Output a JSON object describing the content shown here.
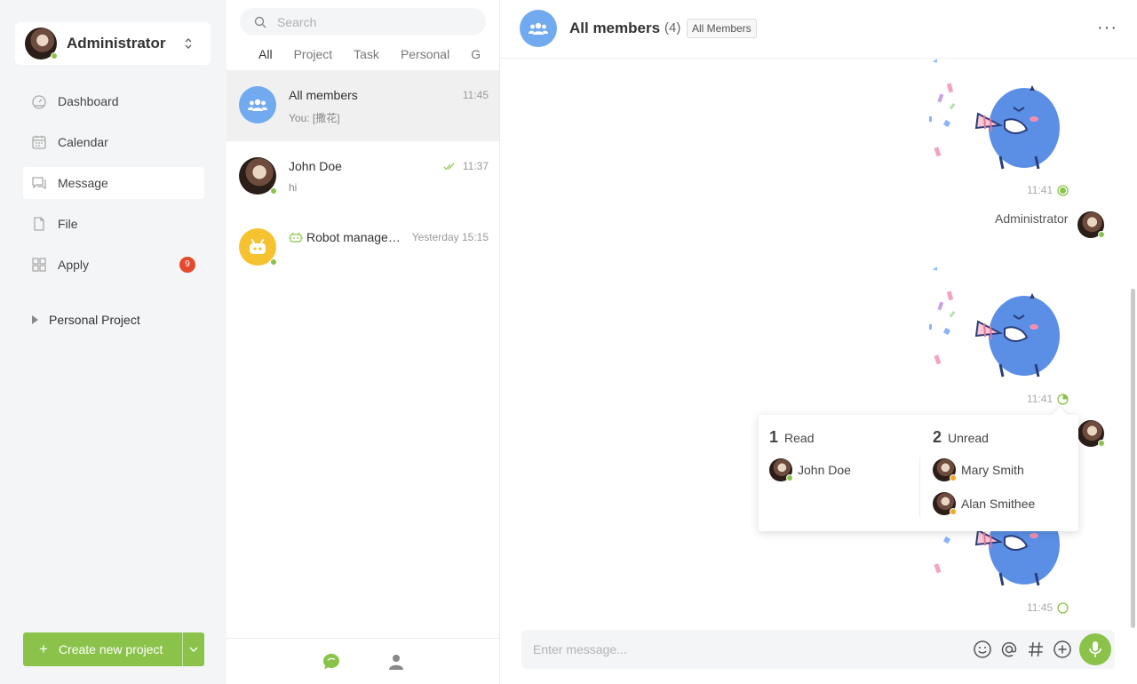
{
  "user": {
    "name": "Administrator"
  },
  "nav": [
    {
      "label": "Dashboard",
      "icon": "dashboard-icon"
    },
    {
      "label": "Calendar",
      "icon": "calendar-icon"
    },
    {
      "label": "Message",
      "icon": "message-icon",
      "active": true
    },
    {
      "label": "File",
      "icon": "file-icon"
    },
    {
      "label": "Apply",
      "icon": "apply-icon",
      "badge": "9"
    }
  ],
  "project_section": {
    "label": "Personal Project"
  },
  "create_button": {
    "label": "Create new project"
  },
  "search": {
    "placeholder": "Search"
  },
  "tabs": [
    "All",
    "Project",
    "Task",
    "Personal",
    "G"
  ],
  "conversations": [
    {
      "name": "All members",
      "time": "11:45",
      "preview": "You: [撒花]"
    },
    {
      "name": "John Doe",
      "time": "11:37",
      "preview": "hi"
    },
    {
      "name": "Robot manage…",
      "time": "Yesterday 15:15",
      "preview": ""
    }
  ],
  "chat": {
    "title": "All members",
    "count": "(4)",
    "tag": "All Members",
    "more": "···",
    "messages": [
      {
        "time": "11:41"
      },
      {
        "time": "11:41"
      },
      {
        "time": "11:45"
      }
    ],
    "sender": "Administrator",
    "input_placeholder": "Enter message..."
  },
  "read_popup": {
    "read_count": "1",
    "read_label": "Read",
    "unread_count": "2",
    "unread_label": "Unread",
    "read_people": [
      "John Doe"
    ],
    "unread_people": [
      "Mary Smith",
      "Alan Smithee"
    ]
  },
  "colors": {
    "accent": "#8bc34a",
    "badge": "#e5492d",
    "group_avatar": "#72aaef",
    "robot_avatar": "#f7c22f"
  }
}
